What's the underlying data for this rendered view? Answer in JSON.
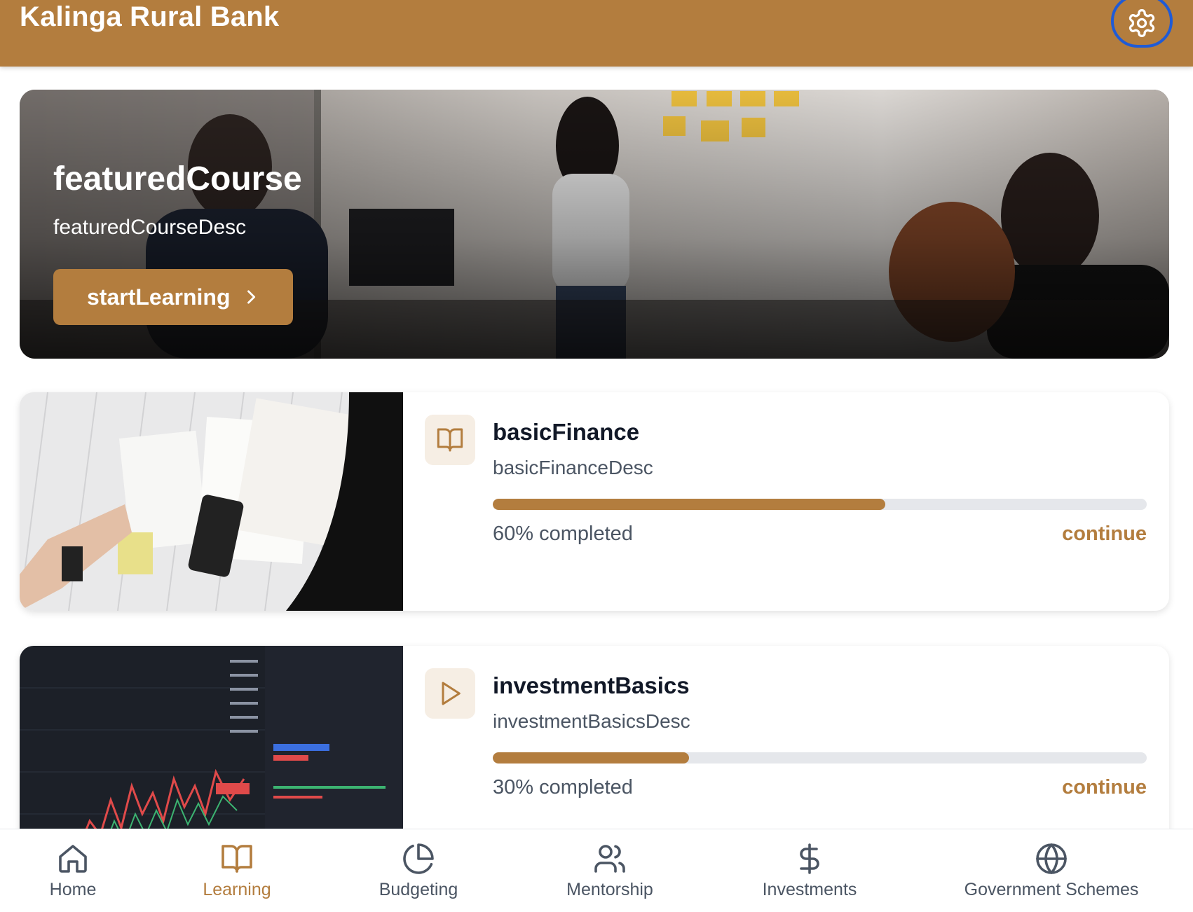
{
  "header": {
    "title": "Kalinga Rural Bank",
    "settings_icon": "gear-icon"
  },
  "hero": {
    "title": "featuredCourse",
    "description": "featuredCourseDesc",
    "button_label": "startLearning",
    "button_icon": "chevron-right-icon"
  },
  "courses": [
    {
      "title": "basicFinance",
      "description": "basicFinanceDesc",
      "icon": "book-open-icon",
      "progress": 60,
      "progress_label": "60% completed",
      "action_label": "continue"
    },
    {
      "title": "investmentBasics",
      "description": "investmentBasicsDesc",
      "icon": "play-icon",
      "progress": 30,
      "progress_label": "30% completed",
      "action_label": "continue"
    }
  ],
  "nav": {
    "items": [
      {
        "label": "Home",
        "icon": "home-icon",
        "active": false
      },
      {
        "label": "Learning",
        "icon": "book-open-icon",
        "active": true
      },
      {
        "label": "Budgeting",
        "icon": "pie-chart-icon",
        "active": false
      },
      {
        "label": "Mentorship",
        "icon": "users-icon",
        "active": false
      },
      {
        "label": "Investments",
        "icon": "dollar-icon",
        "active": false
      },
      {
        "label": "Government Schemes",
        "icon": "globe-icon",
        "active": false
      }
    ]
  },
  "colors": {
    "brand": "#b37d3e",
    "brand_light": "#f6eee4",
    "track": "#e5e7eb",
    "text_muted": "#4b5563"
  }
}
